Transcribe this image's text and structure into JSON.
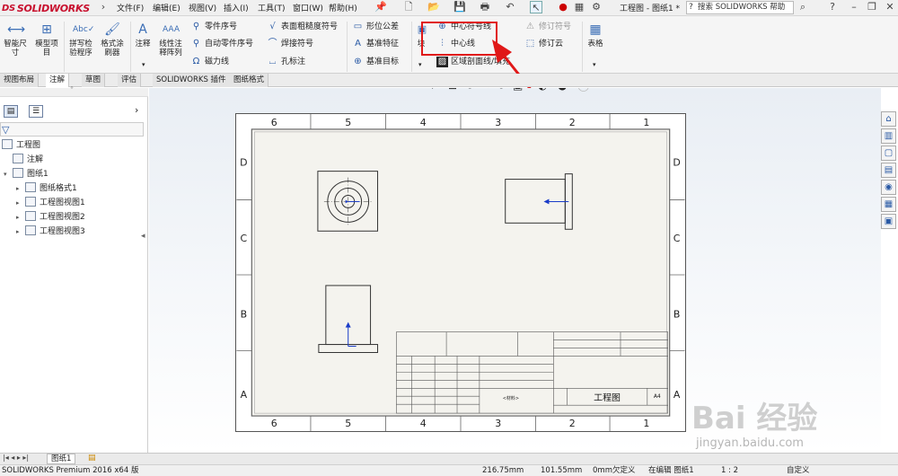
{
  "app": {
    "logo": "SOLIDWORKS",
    "logo_mark": "DS",
    "doc_title": "工程图 - 图纸1 *"
  },
  "menu": [
    "文件(F)",
    "编辑(E)",
    "视图(V)",
    "插入(I)",
    "工具(T)",
    "窗口(W)",
    "帮助(H)"
  ],
  "help_search": "搜索 SOLIDWORKS 帮助",
  "window_controls": [
    "?",
    "–",
    "❐",
    "✕"
  ],
  "ribbon": {
    "smart_dim": "智能尺\n寸",
    "model_items": "模型项\n目",
    "spell": "拼写检\n验程序",
    "format_painter": "格式涂\n刷器",
    "note": "注释",
    "linear_pattern": "线性注\n释阵列",
    "balloon": "零件序号",
    "auto_balloon": "自动零件序号",
    "magnetic_line": "磁力线",
    "surface_finish": "表面粗糙度符号",
    "weld_symbol": "焊接符号",
    "hole_callout": "孔标注",
    "gtol": "形位公差",
    "datum_feature": "基准特征",
    "datum_target": "基准目标",
    "block": "块",
    "center_mark": "中心符号线",
    "centerline": "中心线",
    "area_hatch": "区域剖面线/填充",
    "revision_symbol": "修订符号",
    "revision_cloud": "修订云",
    "table": "表格"
  },
  "tabs": [
    "视图布局",
    "注解",
    "草图",
    "评估",
    "SOLIDWORKS 插件",
    "图纸格式"
  ],
  "active_tab": "注解",
  "tree": {
    "root": "工程图",
    "annotations": "注解",
    "sheet": "图纸1",
    "children": [
      "图纸格式1",
      "工程图视图1",
      "工程图视图2",
      "工程图视图3"
    ]
  },
  "sheet": {
    "cols": [
      "6",
      "5",
      "4",
      "3",
      "2",
      "1"
    ],
    "rows": [
      "D",
      "C",
      "B",
      "A"
    ],
    "title_block_name": "工程图",
    "size": "A4",
    "material": "<材料>"
  },
  "bottom_tab": "图纸1",
  "status": {
    "product": "SOLIDWORKS Premium 2016 x64 版",
    "x": "216.75mm",
    "y": "101.55mm",
    "z": "0mm",
    "defined": "欠定义",
    "editing": "在编辑 图纸1",
    "scale": "1 : 2",
    "units": "自定义"
  },
  "watermark": {
    "brand": "Bai 经验",
    "url": "jingyan.baidu.com"
  },
  "colors": {
    "accent": "#3a6db5",
    "highlight": "#e01818",
    "logo": "#c8102e"
  }
}
